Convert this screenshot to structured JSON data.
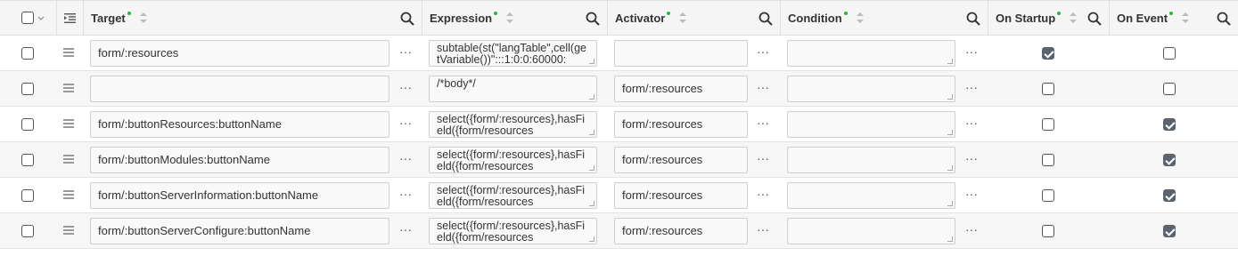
{
  "header": {
    "columns": [
      {
        "label": "Target",
        "required": true
      },
      {
        "label": "Expression",
        "required": true
      },
      {
        "label": "Activator",
        "required": true
      },
      {
        "label": "Condition",
        "required": true
      },
      {
        "label": "On Startup",
        "required": true
      },
      {
        "label": "On Event",
        "required": true
      }
    ]
  },
  "rows": [
    {
      "target": "form/:resources",
      "expression": "subtable(st(\"langTable\",cell(getVariable())\":::1:0:0:60000:",
      "activator": "",
      "condition": "",
      "on_startup": true,
      "on_event": false
    },
    {
      "target": "",
      "expression": "/*body*/",
      "activator": "form/:resources",
      "condition": "",
      "on_startup": false,
      "on_event": false
    },
    {
      "target": "form/:buttonResources:buttonName",
      "expression": "select({form/:resources},hasField({form/resources",
      "activator": "form/:resources",
      "condition": "",
      "on_startup": false,
      "on_event": true
    },
    {
      "target": "form/:buttonModules:buttonName",
      "expression": "select({form/:resources},hasField({form/resources",
      "activator": "form/:resources",
      "condition": "",
      "on_startup": false,
      "on_event": true
    },
    {
      "target": "form/:buttonServerInformation:buttonName",
      "expression": "select({form/:resources},hasField({form/resources",
      "activator": "form/:resources",
      "condition": "",
      "on_startup": false,
      "on_event": true
    },
    {
      "target": "form/:buttonServerConfigure:buttonName",
      "expression": "select({form/:resources},hasField({form/resources",
      "activator": "form/:resources",
      "condition": "",
      "on_startup": false,
      "on_event": true
    }
  ],
  "icons": {
    "search": "search-icon",
    "more": "ellipsis-icon",
    "drag": "drag-handle-icon",
    "indent": "indent-icon"
  },
  "colors": {
    "required_dot": "#2db742",
    "checked": "#5a6470"
  }
}
